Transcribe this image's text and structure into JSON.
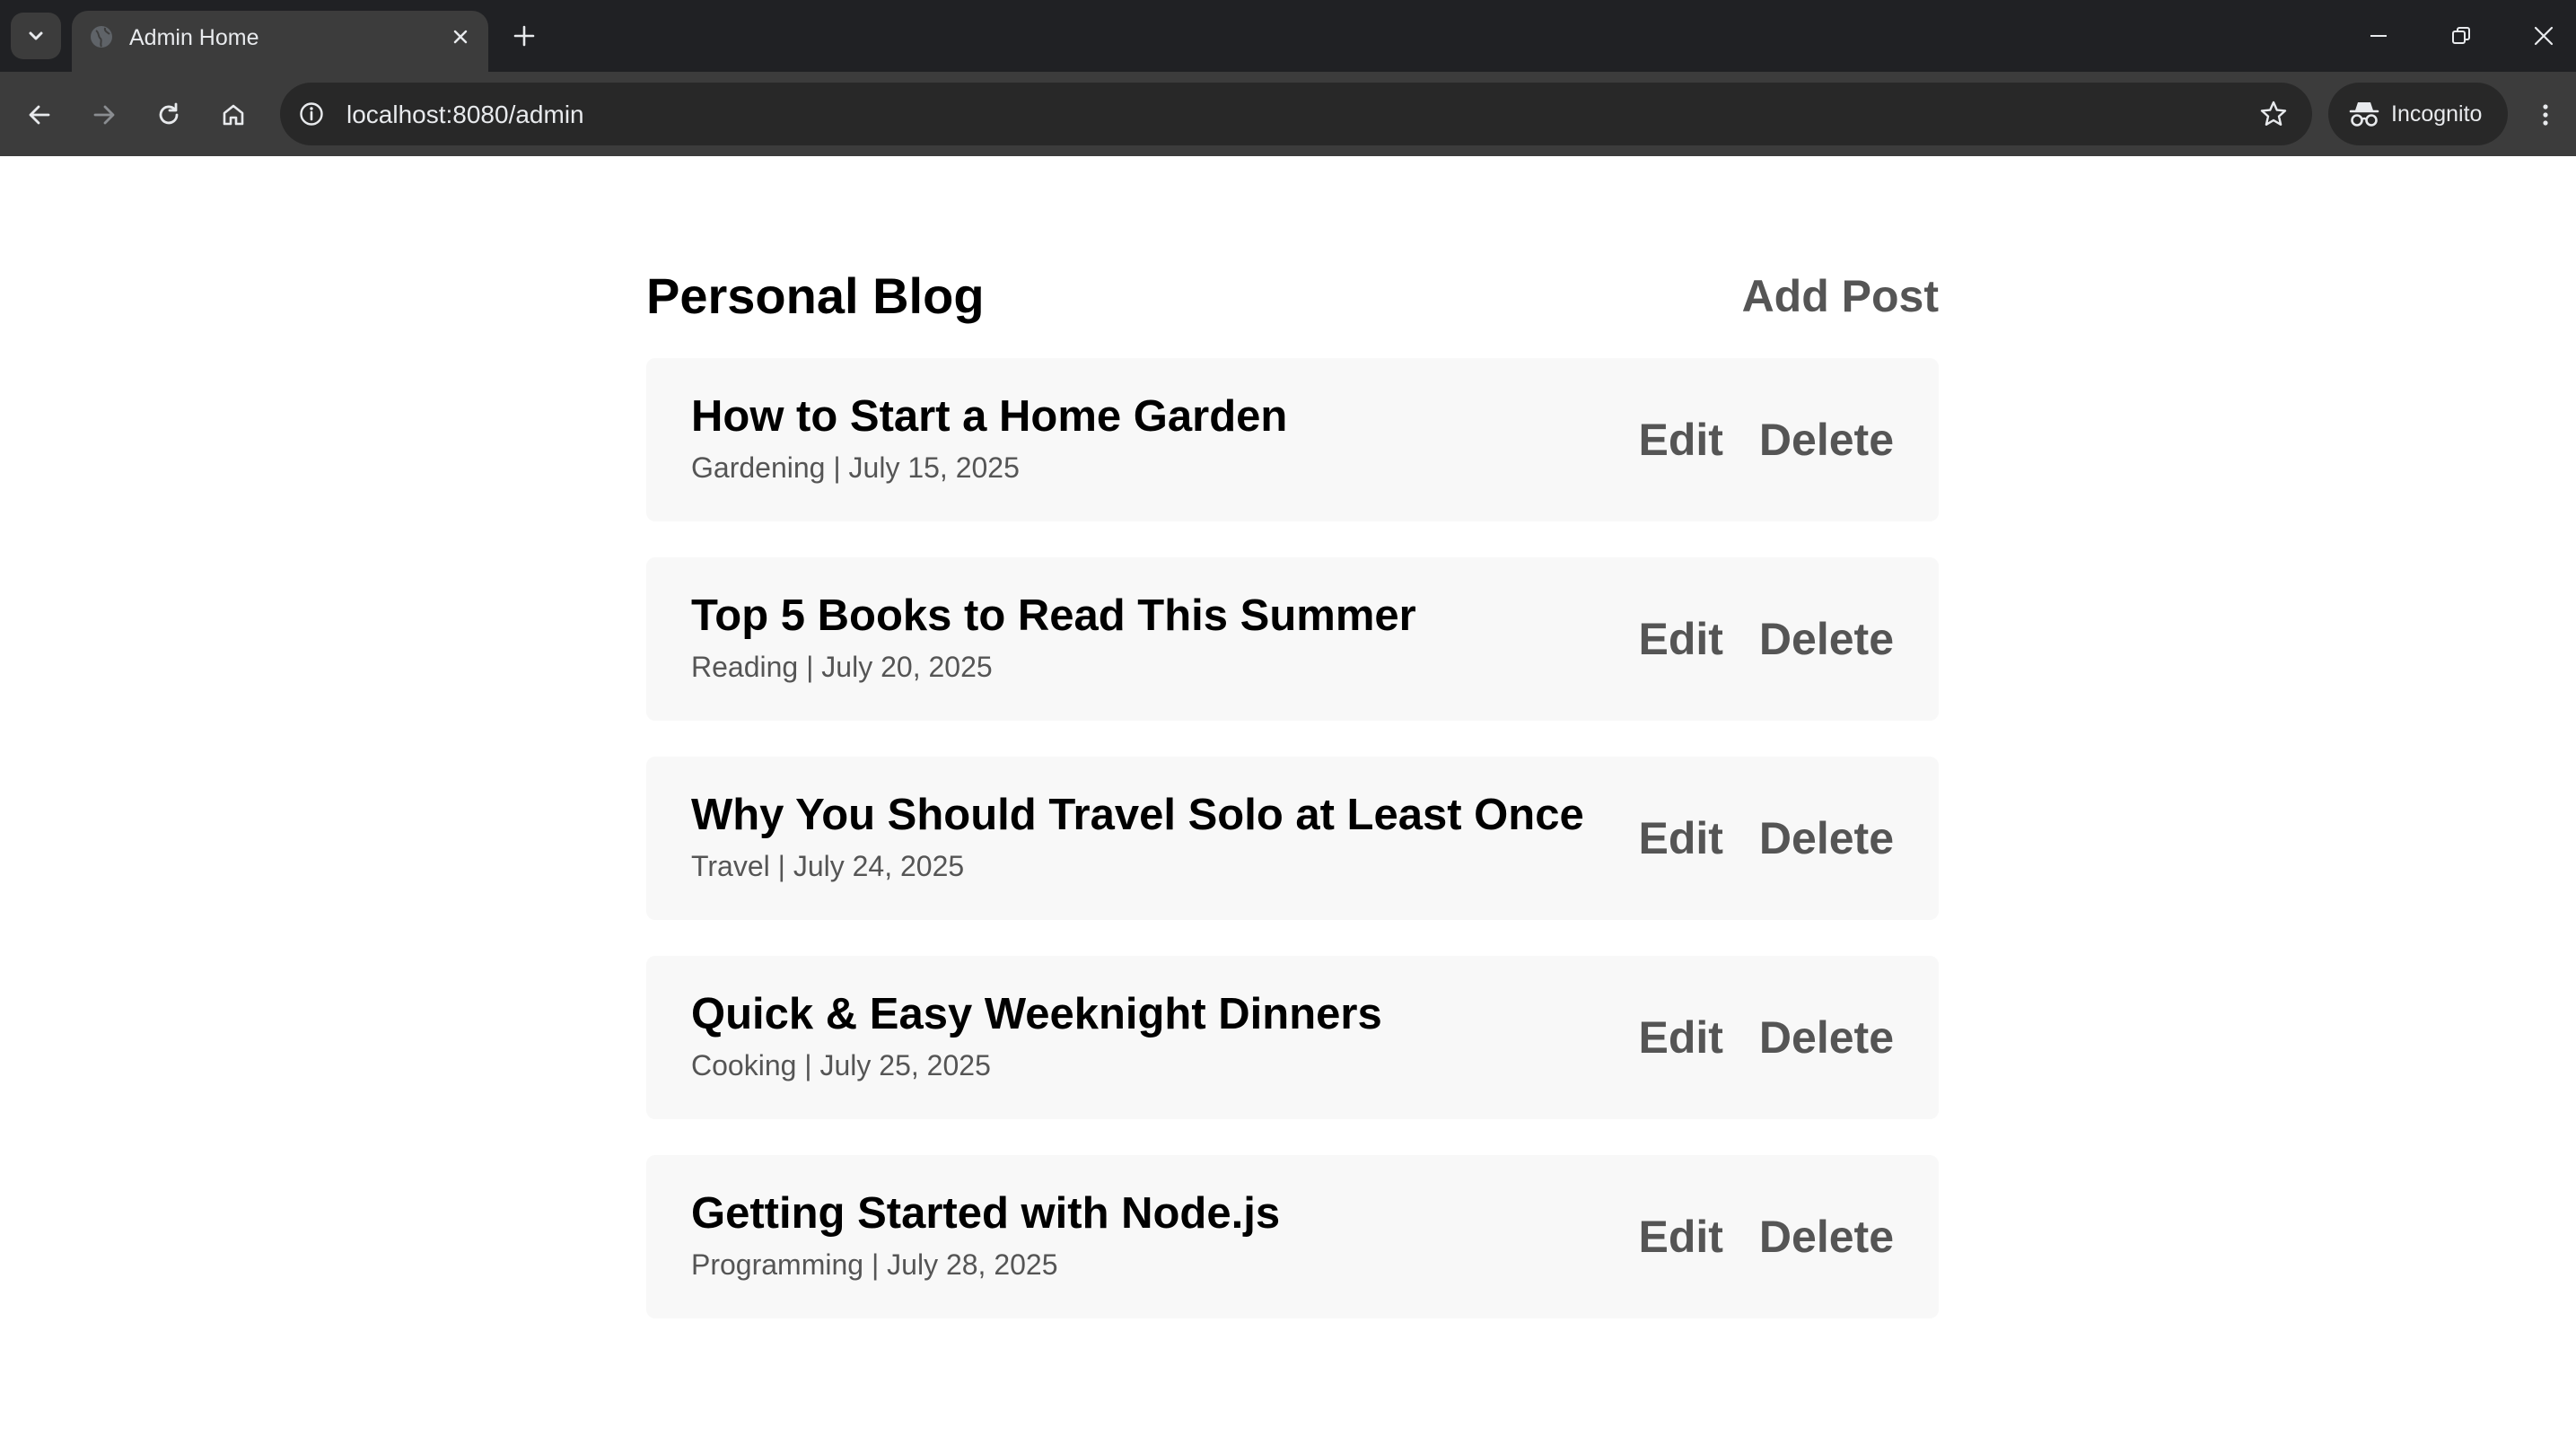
{
  "browser": {
    "tab_title": "Admin Home",
    "url": "localhost:8080/admin",
    "incognito_label": "Incognito",
    "colors": {
      "frame": "#202124",
      "toolbar": "#3c3c3c",
      "omnibox": "#282828",
      "text": "#e8eaed"
    }
  },
  "site": {
    "title": "Personal Blog",
    "add_post_label": "Add Post"
  },
  "posts": [
    {
      "title": "How to Start a Home Garden",
      "meta": "Gardening | July 15, 2025",
      "edit_label": "Edit",
      "delete_label": "Delete"
    },
    {
      "title": "Top 5 Books to Read This Summer",
      "meta": "Reading | July 20, 2025",
      "edit_label": "Edit",
      "delete_label": "Delete"
    },
    {
      "title": "Why You Should Travel Solo at Least Once",
      "meta": "Travel | July 24, 2025",
      "edit_label": "Edit",
      "delete_label": "Delete"
    },
    {
      "title": "Quick & Easy Weeknight Dinners",
      "meta": "Cooking | July 25, 2025",
      "edit_label": "Edit",
      "delete_label": "Delete"
    },
    {
      "title": "Getting Started with Node.js",
      "meta": "Programming | July 28, 2025",
      "edit_label": "Edit",
      "delete_label": "Delete"
    }
  ],
  "icons": {
    "tab_search": "chevron-down-icon",
    "favicon": "globe-icon",
    "close": "close-icon",
    "new_tab": "plus-icon",
    "back": "arrow-left-icon",
    "forward": "arrow-right-icon",
    "reload": "reload-icon",
    "home": "home-icon",
    "site_info": "info-icon",
    "bookmark": "star-icon",
    "incognito": "incognito-icon",
    "menu": "kebab-menu-icon",
    "minimize": "minimize-icon",
    "restore": "restore-icon",
    "window_close": "window-close-icon"
  }
}
